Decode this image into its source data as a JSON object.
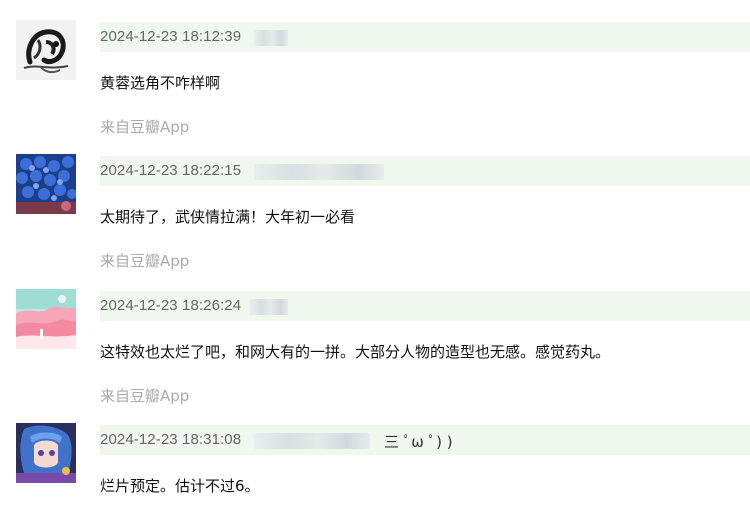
{
  "comments": [
    {
      "avatar": "ink-wash-portrait",
      "timestamp": "2024-12-23 18:12:39",
      "content": "黄蓉选角不咋样啊",
      "source": "来自豆瓣App"
    },
    {
      "avatar": "blue-hydrangea",
      "timestamp": "2024-12-23 18:22:15",
      "content": "太期待了，武侠情拉满！大年初一必看",
      "source": "来自豆瓣App"
    },
    {
      "avatar": "pink-landscape-illustration",
      "timestamp": "2024-12-23 18:26:24",
      "content": "这特效也太烂了吧，和网大有的一拼。大部分人物的造型也无感。感觉药丸。",
      "source": "来自豆瓣App"
    },
    {
      "avatar": "anime-character-blue-hair",
      "timestamp": "2024-12-23 18:31:08",
      "name_visible_tail": "三 ﾟω ﾟ) )",
      "content": "烂片预定。估计不过6。"
    }
  ],
  "colors": {
    "meta_bar": "#f0f7ef",
    "timestamp": "#666666",
    "content": "#111111",
    "source": "#aaaaaa"
  }
}
